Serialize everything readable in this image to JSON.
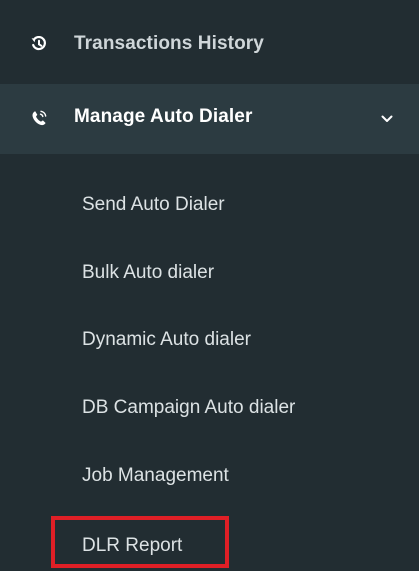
{
  "sidebar": {
    "items": [
      {
        "label": "Transactions History",
        "icon": "history-icon"
      },
      {
        "label": "Manage Auto Dialer",
        "icon": "phone-ringing-icon",
        "expanded": true,
        "chevron": "chevron-down-icon"
      }
    ],
    "submenu": [
      {
        "label": "Send Auto Dialer"
      },
      {
        "label": "Bulk Auto dialer"
      },
      {
        "label": "Dynamic Auto dialer"
      },
      {
        "label": "DB Campaign Auto dialer"
      },
      {
        "label": "Job Management"
      },
      {
        "label": "DLR Report",
        "highlighted": true
      }
    ]
  },
  "colors": {
    "background": "#222d32",
    "active_background": "#2c3b41",
    "text": "#dce2e4",
    "highlight": "#e01f26"
  }
}
